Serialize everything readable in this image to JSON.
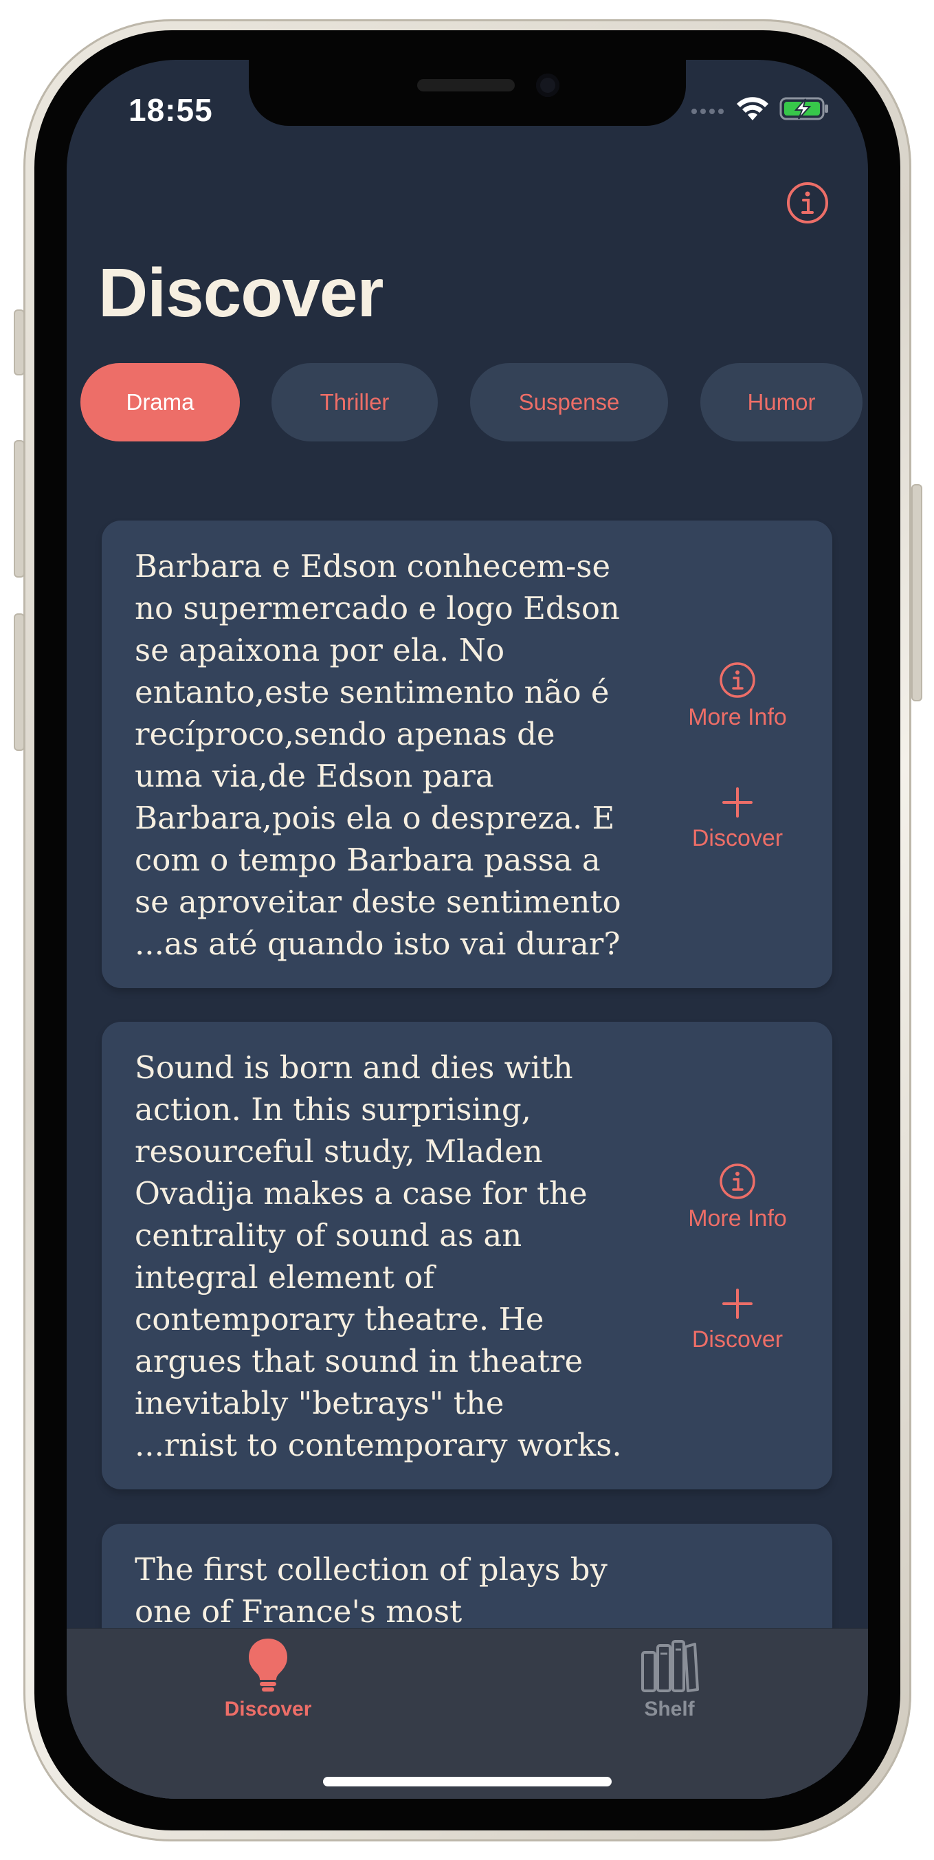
{
  "status_bar": {
    "time": "18:55"
  },
  "header": {
    "title": "Discover"
  },
  "genres": [
    {
      "label": "Drama",
      "active": true
    },
    {
      "label": "Thriller",
      "active": false
    },
    {
      "label": "Suspense",
      "active": false
    },
    {
      "label": "Humor",
      "active": false
    }
  ],
  "cards": [
    {
      "description": "Barbara e Edson conhecem-se\nno supermercado e logo Edson\nse apaixona por ela. No\nentanto,este sentimento não é\nrecíproco,sendo apenas de\numa via,de Edson para\nBarbara,pois ela o despreza. E\ncom o tempo Barbara passa a\nse aproveitar deste sentimento\n...as até quando isto vai durar?",
      "more_info_label": "More Info",
      "discover_label": "Discover"
    },
    {
      "description": "Sound is born and dies with\naction. In this surprising,\nresourceful study, Mladen\nOvadija makes a case for the\ncentrality of sound as an\nintegral element of\ncontemporary theatre. He\nargues that sound in theatre\ninevitably \"betrays\" the\n...rnist to contemporary works.",
      "more_info_label": "More Info",
      "discover_label": "Discover"
    },
    {
      "description": "The first collection of plays by\none of France's most"
    }
  ],
  "tab_bar": {
    "tabs": [
      {
        "label": "Discover",
        "icon": "lightbulb-icon",
        "active": true
      },
      {
        "label": "Shelf",
        "icon": "books-icon",
        "active": false
      }
    ]
  },
  "colors": {
    "background": "#232d3f",
    "card": "#34435b",
    "accent": "#ed6e68",
    "text": "#f6efe1",
    "tab_inactive": "#8a8f98"
  }
}
